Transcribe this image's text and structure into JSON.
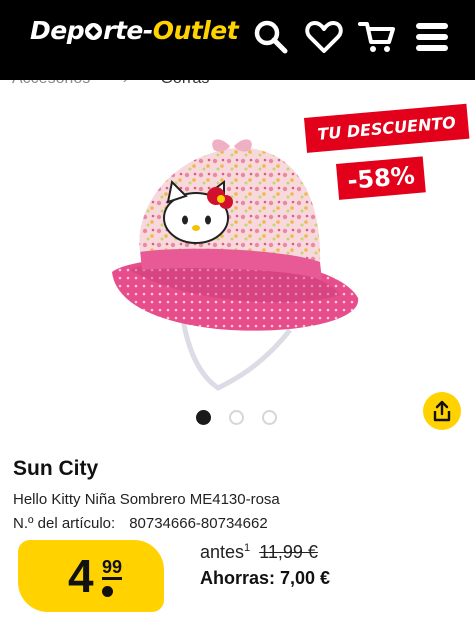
{
  "header": {
    "logo_part1": "Dep",
    "logo_part2": "rte-",
    "logo_part3": "Outlet",
    "icons": [
      "search-icon",
      "heart-icon",
      "cart-icon",
      "menu-icon"
    ]
  },
  "breadcrumb": [
    "Accesorios",
    "›",
    "Gorras"
  ],
  "badge": {
    "label": "TU DESCUENTO",
    "discount": "-58%"
  },
  "gallery": {
    "image_count": 3,
    "active_index": 0
  },
  "product": {
    "brand": "Sun City",
    "name": "Hello Kitty Niña Sombrero ME4130-rosa",
    "article_label": "N.º del artículo:",
    "article_number": "80734666-80734662"
  },
  "price": {
    "integer": "4",
    "decimals": "99",
    "before_label": "antes",
    "before_sup": "1",
    "old_price": "11,99 €",
    "savings": "Ahorras: 7,00 €"
  },
  "colors": {
    "header_bg": "#000000",
    "brand_yellow": "#ffd200",
    "discount_red": "#e2001a"
  }
}
